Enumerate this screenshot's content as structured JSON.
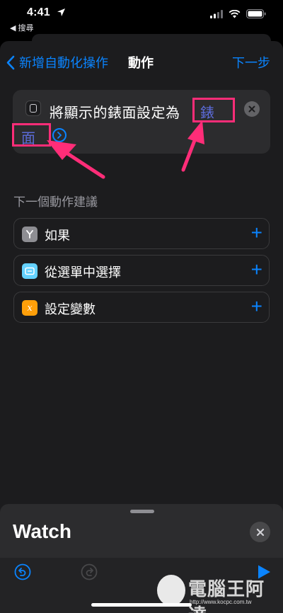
{
  "status_bar": {
    "time": "4:41",
    "back_app": "◀ 搜尋"
  },
  "nav": {
    "back_label": "新增自動化操作",
    "title": "動作",
    "next_label": "下一步"
  },
  "action": {
    "text": "將顯示的錶面設定為",
    "param_part1": "錶",
    "param_part2": "面"
  },
  "suggestions": {
    "title": "下一個動作建議",
    "items": [
      {
        "label": "如果",
        "icon": "if-branch-icon",
        "color": "#8e8e93"
      },
      {
        "label": "從選單中選擇",
        "icon": "menu-icon",
        "color": "#64d2ff"
      },
      {
        "label": "設定變數",
        "icon": "variable-icon",
        "color": "#ff9f0a"
      }
    ]
  },
  "panel": {
    "title": "Watch"
  },
  "watermark": {
    "text": "電腦王阿達",
    "url": "http://www.kocpc.com.tw"
  },
  "colors": {
    "accent": "#0a84ff",
    "highlight": "#ff2d78",
    "param": "#5b6bd8"
  }
}
